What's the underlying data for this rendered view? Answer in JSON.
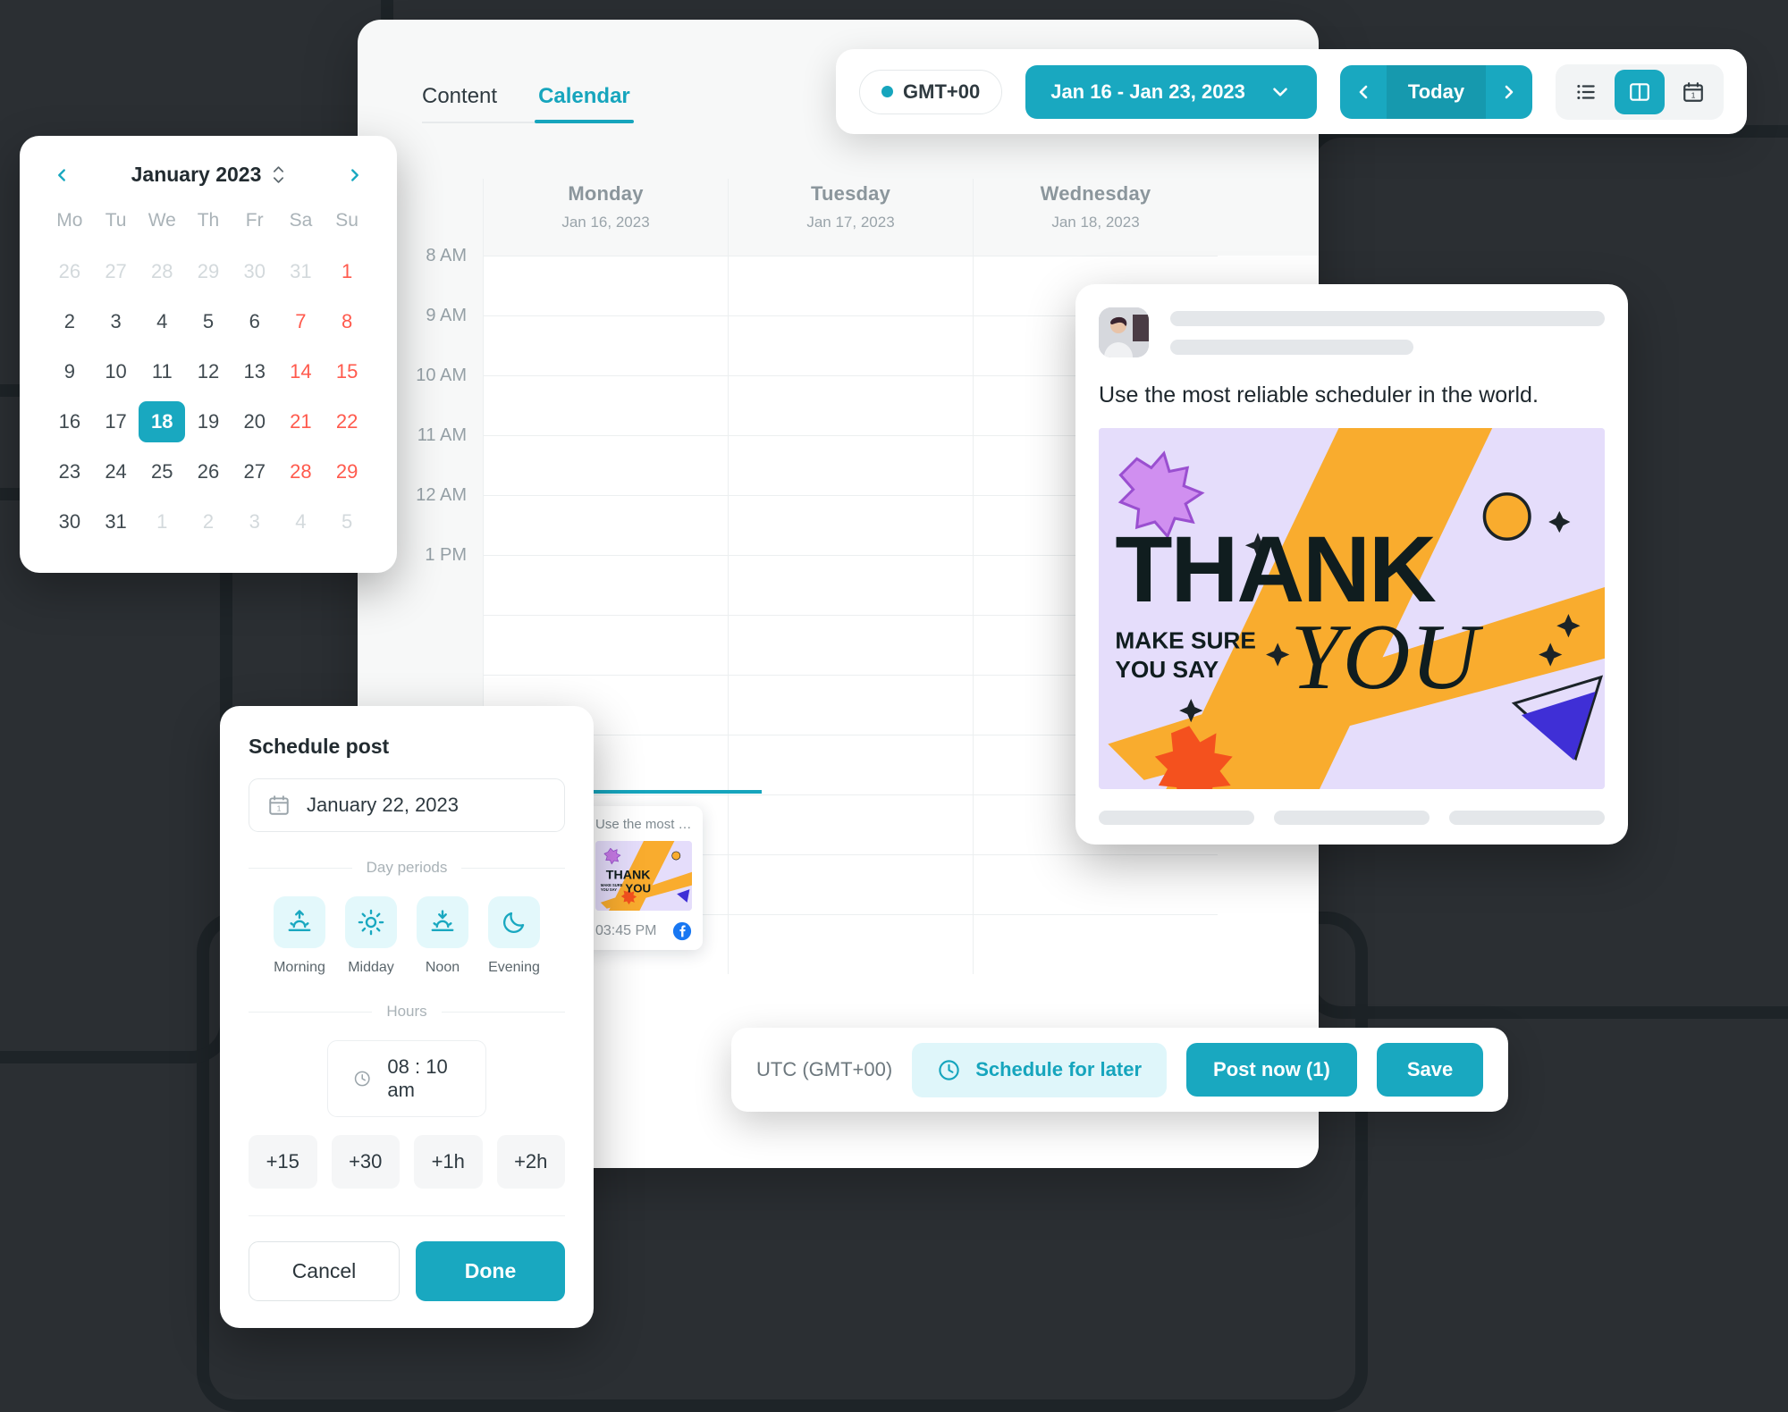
{
  "app": {
    "tabs": [
      {
        "label": "Content",
        "active": false
      },
      {
        "label": "Calendar",
        "active": true
      }
    ]
  },
  "toolbar": {
    "timezone_label": "GMT+00",
    "date_range": "Jan 16 - Jan 23, 2023",
    "today_label": "Today",
    "prev_icon": "chevron-left-icon",
    "next_icon": "chevron-right-icon",
    "chevron_icon": "chevron-down-icon",
    "views": [
      {
        "name": "list-view",
        "icon": "list-icon",
        "active": false
      },
      {
        "name": "column-view",
        "icon": "columns-icon",
        "active": true
      },
      {
        "name": "day-view",
        "icon": "calendar-day-icon",
        "active": false
      }
    ]
  },
  "calendar_grid": {
    "days": [
      {
        "name": "Monday",
        "date": "Jan 16, 2023"
      },
      {
        "name": "Tuesday",
        "date": "Jan 17, 2023"
      },
      {
        "name": "Wednesday",
        "date": "Jan 18, 2023"
      }
    ],
    "hours": [
      "8 AM",
      "9 AM",
      "10 AM",
      "11 AM",
      "12 AM",
      "1 PM"
    ],
    "event": {
      "title": "Use the most rel...",
      "time": "03:45 PM",
      "network_icon": "facebook-icon"
    }
  },
  "datepicker": {
    "title": "January 2023",
    "prev_icon": "chevron-left-icon",
    "next_icon": "chevron-right-icon",
    "stepper_icon": "stepper-updown-icon",
    "weekdays": [
      "Mo",
      "Tu",
      "We",
      "Th",
      "Fr",
      "Sa",
      "Su"
    ],
    "weeks": [
      [
        {
          "d": "26",
          "type": "muted"
        },
        {
          "d": "27",
          "type": "muted"
        },
        {
          "d": "28",
          "type": "muted"
        },
        {
          "d": "29",
          "type": "muted"
        },
        {
          "d": "30",
          "type": "muted"
        },
        {
          "d": "31",
          "type": "muted"
        },
        {
          "d": "1",
          "type": "weekend"
        }
      ],
      [
        {
          "d": "2",
          "type": ""
        },
        {
          "d": "3",
          "type": ""
        },
        {
          "d": "4",
          "type": ""
        },
        {
          "d": "5",
          "type": ""
        },
        {
          "d": "6",
          "type": ""
        },
        {
          "d": "7",
          "type": "weekend"
        },
        {
          "d": "8",
          "type": "weekend"
        }
      ],
      [
        {
          "d": "9",
          "type": ""
        },
        {
          "d": "10",
          "type": ""
        },
        {
          "d": "11",
          "type": ""
        },
        {
          "d": "12",
          "type": ""
        },
        {
          "d": "13",
          "type": ""
        },
        {
          "d": "14",
          "type": "weekend"
        },
        {
          "d": "15",
          "type": "weekend"
        }
      ],
      [
        {
          "d": "16",
          "type": ""
        },
        {
          "d": "17",
          "type": ""
        },
        {
          "d": "18",
          "type": "sel"
        },
        {
          "d": "19",
          "type": ""
        },
        {
          "d": "20",
          "type": ""
        },
        {
          "d": "21",
          "type": "weekend"
        },
        {
          "d": "22",
          "type": "weekend"
        }
      ],
      [
        {
          "d": "23",
          "type": ""
        },
        {
          "d": "24",
          "type": ""
        },
        {
          "d": "25",
          "type": ""
        },
        {
          "d": "26",
          "type": ""
        },
        {
          "d": "27",
          "type": ""
        },
        {
          "d": "28",
          "type": "weekend"
        },
        {
          "d": "29",
          "type": "weekend"
        }
      ],
      [
        {
          "d": "30",
          "type": ""
        },
        {
          "d": "31",
          "type": ""
        },
        {
          "d": "1",
          "type": "muted"
        },
        {
          "d": "2",
          "type": "muted"
        },
        {
          "d": "3",
          "type": "muted"
        },
        {
          "d": "4",
          "type": "muted"
        },
        {
          "d": "5",
          "type": "muted"
        }
      ]
    ],
    "selected_day": "18"
  },
  "schedule_modal": {
    "title": "Schedule post",
    "date_value": "January 22, 2023",
    "date_icon": "calendar-icon",
    "day_periods_label": "Day periods",
    "periods": [
      {
        "label": "Morning",
        "icon": "sunrise-icon"
      },
      {
        "label": "Midday",
        "icon": "sun-icon"
      },
      {
        "label": "Noon",
        "icon": "sunset-icon"
      },
      {
        "label": "Evening",
        "icon": "moon-icon"
      }
    ],
    "hours_label": "Hours",
    "time_value": "08 : 10 am",
    "time_icon": "clock-icon",
    "quick_adds": [
      "+15",
      "+30",
      "+1h",
      "+2h"
    ],
    "cancel_label": "Cancel",
    "done_label": "Done"
  },
  "post_preview": {
    "caption": "Use the most reliable scheduler in the world.",
    "artwork": {
      "line1": "THANK",
      "line2": "YOU",
      "small1": "MAKE SURE",
      "small2": "YOU SAY"
    }
  },
  "action_bar": {
    "timezone": "UTC (GMT+00)",
    "schedule_label": "Schedule for later",
    "schedule_icon": "clock-icon",
    "post_now_label": "Post now (1)",
    "save_label": "Save"
  },
  "colors": {
    "accent": "#19a8c0",
    "accent_soft": "#dff6fa",
    "weekend": "#ff5a4d",
    "artwork_bg": "#e5ddfb",
    "artwork_yellow": "#f9ac2e",
    "facebook": "#1877f2"
  }
}
